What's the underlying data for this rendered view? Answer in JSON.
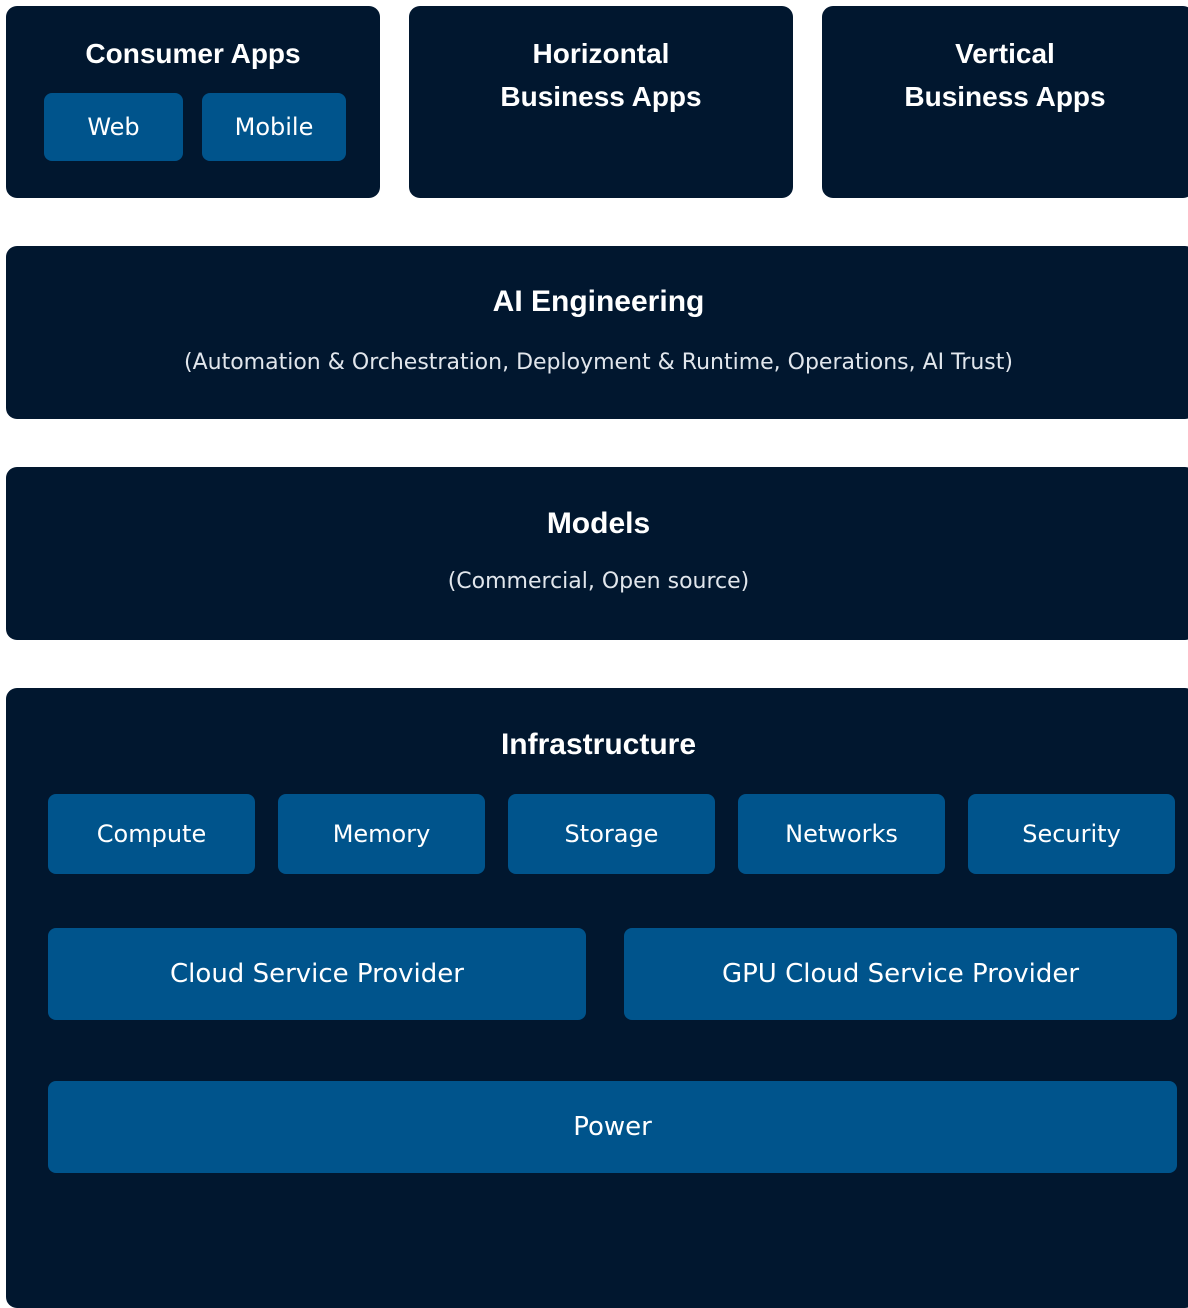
{
  "consumer_apps": {
    "title": "Consumer Apps",
    "items": [
      "Web",
      "Mobile"
    ]
  },
  "horizontal_apps": {
    "title_line1": "Horizontal",
    "title_line2": "Business Apps"
  },
  "vertical_apps": {
    "title_line1": "Vertical",
    "title_line2": "Business Apps"
  },
  "ai_engineering": {
    "title": "AI Engineering",
    "subtitle": "(Automation & Orchestration, Deployment & Runtime, Operations, AI Trust)"
  },
  "models": {
    "title": "Models",
    "subtitle": "(Commercial, Open source)"
  },
  "infrastructure": {
    "title": "Infrastructure",
    "components": [
      "Compute",
      "Memory",
      "Storage",
      "Networks",
      "Security"
    ],
    "providers": [
      "Cloud Service Provider",
      "GPU Cloud Service Provider"
    ],
    "power": "Power"
  },
  "colors": {
    "panel_bg": "#01172f",
    "chip_bg": "#00548c",
    "text": "#ffffff",
    "subtitle_text": "#e1e6ec"
  }
}
